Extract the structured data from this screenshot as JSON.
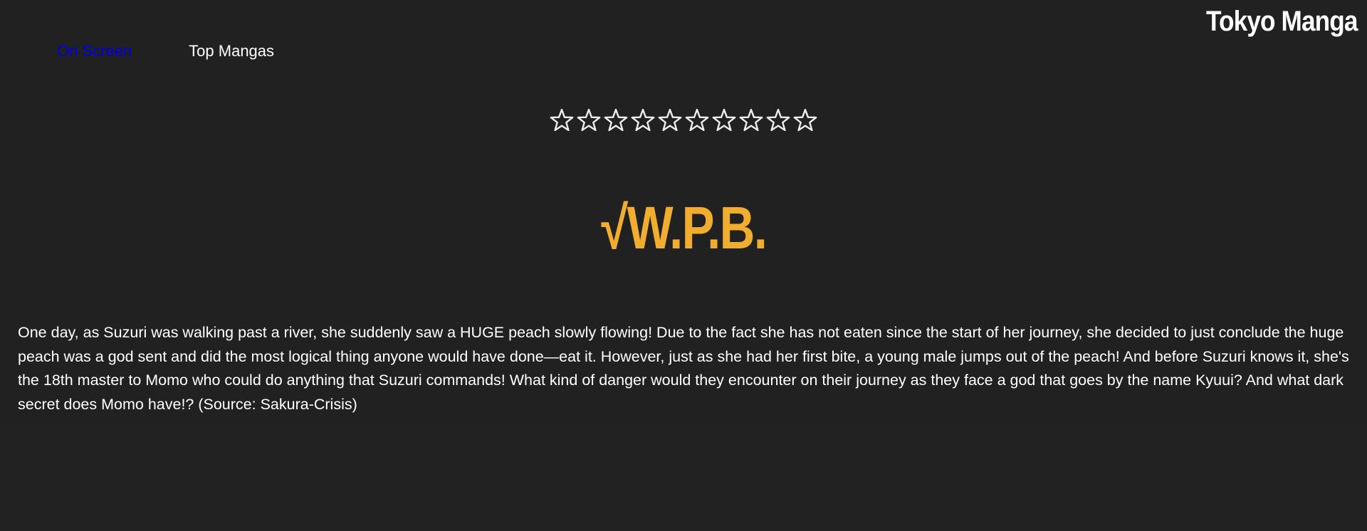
{
  "header": {
    "site_title": "Tokyo Manga"
  },
  "nav": {
    "items": [
      {
        "label": "On Screen",
        "color": "#0000ee"
      },
      {
        "label": "Top Mangas",
        "color": "#ffffff"
      }
    ]
  },
  "rating": {
    "total_stars": 10,
    "filled_stars": 0,
    "star_glyph": "☆",
    "icon": "star-outline-icon"
  },
  "manga": {
    "title": "√W.P.B.",
    "title_color": "#f0ad30",
    "synopsis": "One day, as Suzuri was walking past a river, she suddenly saw a HUGE peach slowly flowing! Due to the fact she has not eaten since the start of her journey, she decided to just conclude the huge peach was a god sent and did the most logical thing anyone would have done—eat it. However, just as she had her first bite, a young male jumps out of the peach! And before Suzuri knows it, she's the 18th master to Momo who could do anything that Suzuri commands! What kind of danger would they encounter on their journey as they face a god that goes by the name Kyuui? And what dark secret does Momo have!? (Source: Sakura-Crisis)"
  },
  "colors": {
    "background": "#222222",
    "accent": "#f0ad30",
    "text": "#ffffff",
    "link": "#0000ee"
  }
}
